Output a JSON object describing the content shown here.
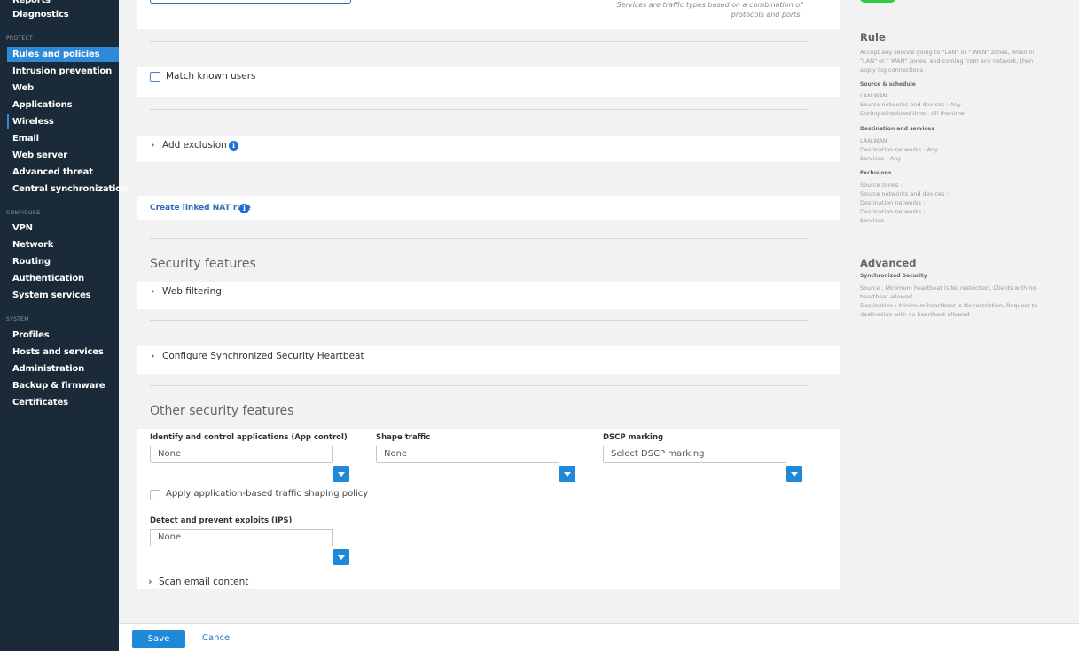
{
  "sidebar": {
    "items": [
      {
        "label": "Reports"
      },
      {
        "label": "Diagnostics"
      },
      {
        "label": "Rules and policies"
      },
      {
        "label": "Intrusion prevention"
      },
      {
        "label": "Web"
      },
      {
        "label": "Applications"
      },
      {
        "label": "Wireless"
      },
      {
        "label": "Email"
      },
      {
        "label": "Web server"
      },
      {
        "label": "Advanced threat"
      },
      {
        "label": "Central synchronization"
      },
      {
        "label": "VPN"
      },
      {
        "label": "Network"
      },
      {
        "label": "Routing"
      },
      {
        "label": "Authentication"
      },
      {
        "label": "System services"
      },
      {
        "label": "Profiles"
      },
      {
        "label": "Hosts and services"
      },
      {
        "label": "Administration"
      },
      {
        "label": "Backup & firmware"
      },
      {
        "label": "Certificates"
      }
    ],
    "sections": {
      "protect": "PROTECT",
      "configure": "CONFIGURE",
      "system": "SYSTEM"
    }
  },
  "main": {
    "services_note_line1": "Services are traffic types based on a combination of",
    "services_note_line2": "protocols and ports.",
    "match_known_users": "Match known users",
    "add_exclusion": "Add exclusion",
    "create_nat_rule": "Create linked NAT rule",
    "security_features_title": "Security features",
    "web_filtering": "Web filtering",
    "configure_heartbeat": "Configure Synchronized Security Heartbeat",
    "other_security_title": "Other security features",
    "app_control_label": "Identify and control applications (App control)",
    "app_control_value": "None",
    "shape_traffic_label": "Shape traffic",
    "shape_traffic_value": "None",
    "dscp_label": "DSCP marking",
    "dscp_value": "Select DSCP marking",
    "apply_shaping": "Apply application-based traffic shaping policy",
    "ips_label": "Detect and prevent exploits (IPS)",
    "ips_value": "None",
    "scan_email": "Scan email content"
  },
  "right_panel": {
    "rule_title": "Rule",
    "rule_desc": "Accept any service going to \"LAN\" or \" WAN\" zones, when in \"LAN\" or \" WAN\" zones, and coming from any network, then apply log connections",
    "source_title": "Source & schedule",
    "source_zones": "LAN,WAN",
    "source_networks": "Source networks and devices : Any",
    "source_time": "During scheduled time : All the time",
    "dest_title": "Destination and services",
    "dest_zones": "LAN,WAN",
    "dest_networks": "Destination networks : Any",
    "dest_services": "Services : Any",
    "excl_title": "Exclusions",
    "excl_source_zones": "Source zones :",
    "excl_source_networks": "Source networks and devices :",
    "excl_dest_networks1": "Destination networks :",
    "excl_dest_networks2": "Destination networks :",
    "excl_services": "Services :",
    "advanced_title": "Advanced",
    "sync_title": "Synchronized Security",
    "sync_source": "Source : Minimum heartbeat is No restriction, Clients with no heartbeat allowed",
    "sync_dest": "Destination : Minimum heartbeat is No restriction, Request to destination with no heartbeat allowed"
  },
  "footer": {
    "save": "Save",
    "cancel": "Cancel"
  },
  "colors": {
    "sidebar_bg": "#1b2a38",
    "accent": "#1e88d9",
    "active_nav": "#2e8ad8",
    "toggle_green": "#2ecc40"
  }
}
